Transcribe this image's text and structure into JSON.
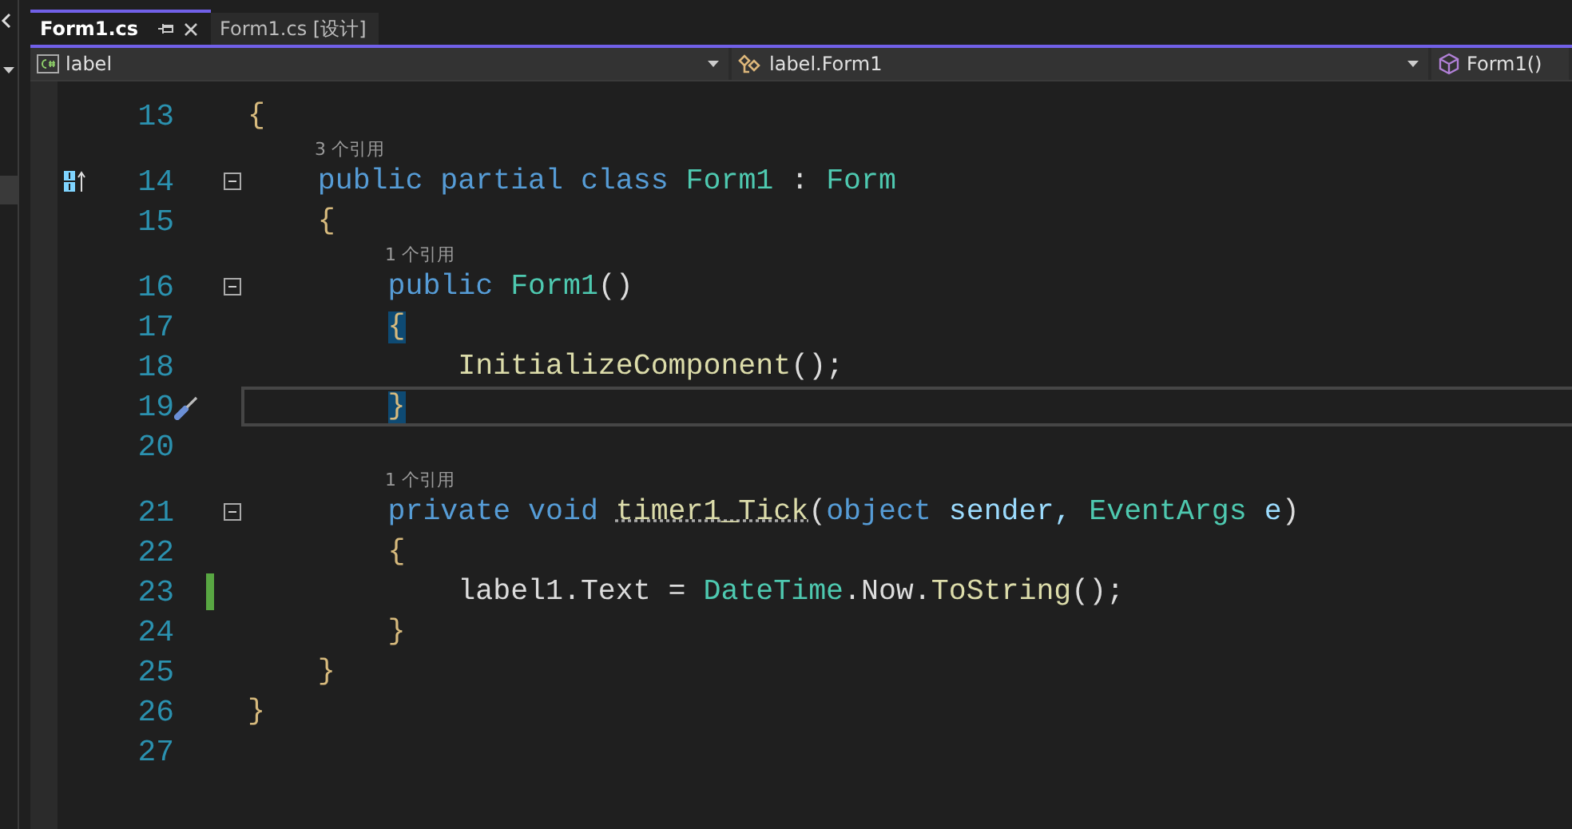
{
  "tabs": [
    {
      "label": "Form1.cs",
      "selected": true,
      "pinned": true
    },
    {
      "label": "Form1.cs [设计]",
      "selected": false,
      "pinned": false
    }
  ],
  "navigation": [
    {
      "kind": "project",
      "label": "label"
    },
    {
      "kind": "class",
      "label": "label.Form1"
    },
    {
      "kind": "member",
      "label": "Form1()"
    }
  ],
  "lines": [
    {
      "number": "13",
      "kind": "plain",
      "tokens": [
        {
          "text": "{",
          "kind": "brace"
        }
      ]
    },
    {
      "number": "14",
      "kind": "implements",
      "lens": "3 个引用",
      "collapsible": true,
      "tokens": [
        {
          "text": "    public partial class ",
          "kind": "keyword"
        },
        {
          "text": "Form1",
          "kind": "type"
        },
        {
          "text": " : ",
          "kind": "plain"
        },
        {
          "text": "Form",
          "kind": "type"
        }
      ]
    },
    {
      "number": "15",
      "kind": "plain",
      "tokens": [
        {
          "text": "    {",
          "kind": "brace"
        }
      ]
    },
    {
      "number": "16",
      "kind": "plain",
      "lens": "1 个引用",
      "collapsible": true,
      "tokens": [
        {
          "text": "        public ",
          "kind": "keyword"
        },
        {
          "text": "Form1",
          "kind": "type"
        },
        {
          "text": "()",
          "kind": "plain"
        }
      ]
    },
    {
      "number": "17",
      "kind": "plain",
      "tokens": [
        {
          "text": "        {",
          "kind": "brace",
          "matched": true
        }
      ]
    },
    {
      "number": "18",
      "kind": "plain",
      "tokens": [
        {
          "text": "            InitializeComponent",
          "kind": "method"
        },
        {
          "text": "();",
          "kind": "plain"
        }
      ]
    },
    {
      "number": "19",
      "kind": "quick-action",
      "current": true,
      "tokens": [
        {
          "text": "        }",
          "kind": "brace",
          "matched": true
        }
      ]
    },
    {
      "number": "20",
      "kind": "plain"
    },
    {
      "number": "21",
      "kind": "plain",
      "lens": "1 个引用",
      "collapsible": true,
      "tokens": [
        {
          "text": "        private void ",
          "kind": "keyword"
        },
        {
          "text": "timer1_Tick",
          "kind": "method",
          "underlined": true
        },
        {
          "text": "(",
          "kind": "plain"
        },
        {
          "text": "object",
          "kind": "keyword"
        },
        {
          "text": " sender, ",
          "kind": "param"
        },
        {
          "text": "EventArgs",
          "kind": "type"
        },
        {
          "text": " e",
          "kind": "param"
        },
        {
          "text": ")",
          "kind": "plain"
        }
      ]
    },
    {
      "number": "22",
      "kind": "plain",
      "tokens": [
        {
          "text": "        {",
          "kind": "brace"
        }
      ]
    },
    {
      "number": "23",
      "kind": "plain",
      "changed": true,
      "tokens": [
        {
          "text": "            label1.Text = ",
          "kind": "plain"
        },
        {
          "text": "DateTime",
          "kind": "type"
        },
        {
          "text": ".Now.",
          "kind": "plain"
        },
        {
          "text": "ToString",
          "kind": "method"
        },
        {
          "text": "();",
          "kind": "plain"
        }
      ]
    },
    {
      "number": "24",
      "kind": "plain",
      "tokens": [
        {
          "text": "        }",
          "kind": "brace"
        }
      ]
    },
    {
      "number": "25",
      "kind": "plain",
      "tokens": [
        {
          "text": "    }",
          "kind": "brace"
        }
      ]
    },
    {
      "number": "26",
      "kind": "plain",
      "tokens": [
        {
          "text": "}",
          "kind": "brace"
        }
      ]
    },
    {
      "number": "27",
      "kind": "plain"
    }
  ]
}
